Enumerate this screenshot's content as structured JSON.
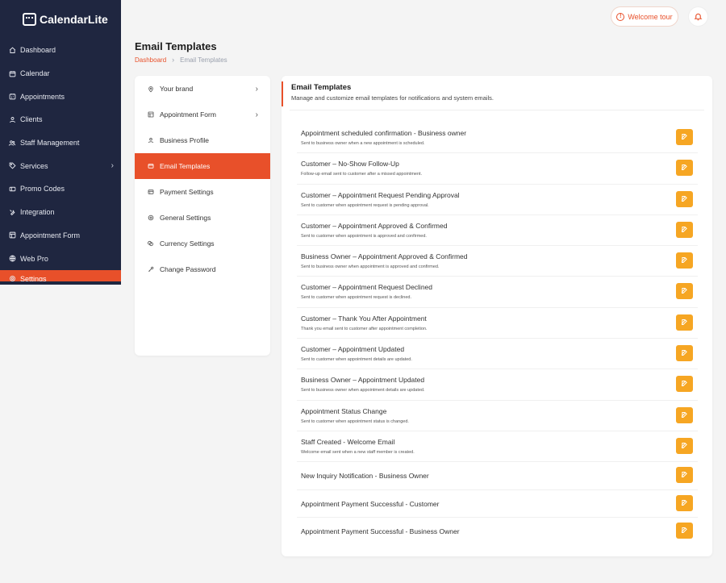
{
  "app": {
    "brand": "CalendarLite"
  },
  "sidebar": {
    "items": [
      {
        "label": "Dashboard",
        "icon": "home-icon"
      },
      {
        "label": "Calendar",
        "icon": "calendar-icon"
      },
      {
        "label": "Appointments",
        "icon": "appointments-icon"
      },
      {
        "label": "Clients",
        "icon": "user-icon"
      },
      {
        "label": "Staff Management",
        "icon": "users-icon"
      },
      {
        "label": "Services",
        "icon": "tag-icon",
        "has_submenu": true
      },
      {
        "label": "Promo Codes",
        "icon": "ticket-icon"
      },
      {
        "label": "Integration",
        "icon": "tools-icon"
      },
      {
        "label": "Appointment Form",
        "icon": "form-icon"
      },
      {
        "label": "Web Pro",
        "icon": "globe-icon"
      },
      {
        "label": "Settings",
        "icon": "gear-icon",
        "active": true
      }
    ]
  },
  "topbar": {
    "welcome_label": "Welcome tour"
  },
  "header": {
    "title": "Email Templates",
    "breadcrumb": {
      "home": "Dashboard",
      "current": "Email Templates"
    }
  },
  "settings_menu": {
    "items": [
      {
        "label": "Your brand",
        "icon": "pin-icon",
        "has_submenu": true
      },
      {
        "label": "Appointment Form",
        "icon": "grid-icon",
        "has_submenu": true
      },
      {
        "label": "Business Profile",
        "icon": "profile-icon"
      },
      {
        "label": "Email Templates",
        "icon": "mail-icon",
        "active": true
      },
      {
        "label": "Payment Settings",
        "icon": "card-icon"
      },
      {
        "label": "General Settings",
        "icon": "settings-icon"
      },
      {
        "label": "Currency Settings",
        "icon": "coins-icon"
      },
      {
        "label": "Change Password",
        "icon": "key-icon"
      }
    ]
  },
  "templates": {
    "title": "Email Templates",
    "subtitle": "Manage and customize email templates for notifications and system emails.",
    "items": [
      {
        "name": "Appointment scheduled confirmation - Business owner",
        "description": "Sent to business owner when a new appointment is scheduled."
      },
      {
        "name": "Customer – No-Show Follow-Up",
        "description": "Follow-up email sent to customer after a missed appointment."
      },
      {
        "name": "Customer – Appointment Request Pending Approval",
        "description": "Sent to customer when appointment request is pending approval."
      },
      {
        "name": "Customer – Appointment Approved & Confirmed",
        "description": "Sent to customer when appointment is approved and confirmed."
      },
      {
        "name": "Business Owner – Appointment Approved & Confirmed",
        "description": "Sent to business owner when appointment is approved and confirmed."
      },
      {
        "name": "Customer – Appointment Request Declined",
        "description": "Sent to customer when appointment request is declined."
      },
      {
        "name": "Customer – Thank You After Appointment",
        "description": "Thank you email sent to customer after appointment completion."
      },
      {
        "name": "Customer – Appointment Updated",
        "description": "Sent to customer when appointment details are updated."
      },
      {
        "name": "Business Owner – Appointment Updated",
        "description": "Sent to business owner when appointment details are updated."
      },
      {
        "name": "Appointment Status Change",
        "description": "Sent to customer when appointment status is changed."
      },
      {
        "name": "Staff Created - Welcome Email",
        "description": "Welcome email sent when a new staff member is created."
      },
      {
        "name": "New Inquiry Notification - Business Owner",
        "description": ""
      },
      {
        "name": "Appointment Payment Successful - Customer",
        "description": ""
      },
      {
        "name": "Appointment Payment Successful - Business Owner",
        "description": ""
      }
    ]
  },
  "colors": {
    "sidebar_bg": "#1f2640",
    "accent": "#e8502a",
    "edit_button": "#f6a623"
  }
}
